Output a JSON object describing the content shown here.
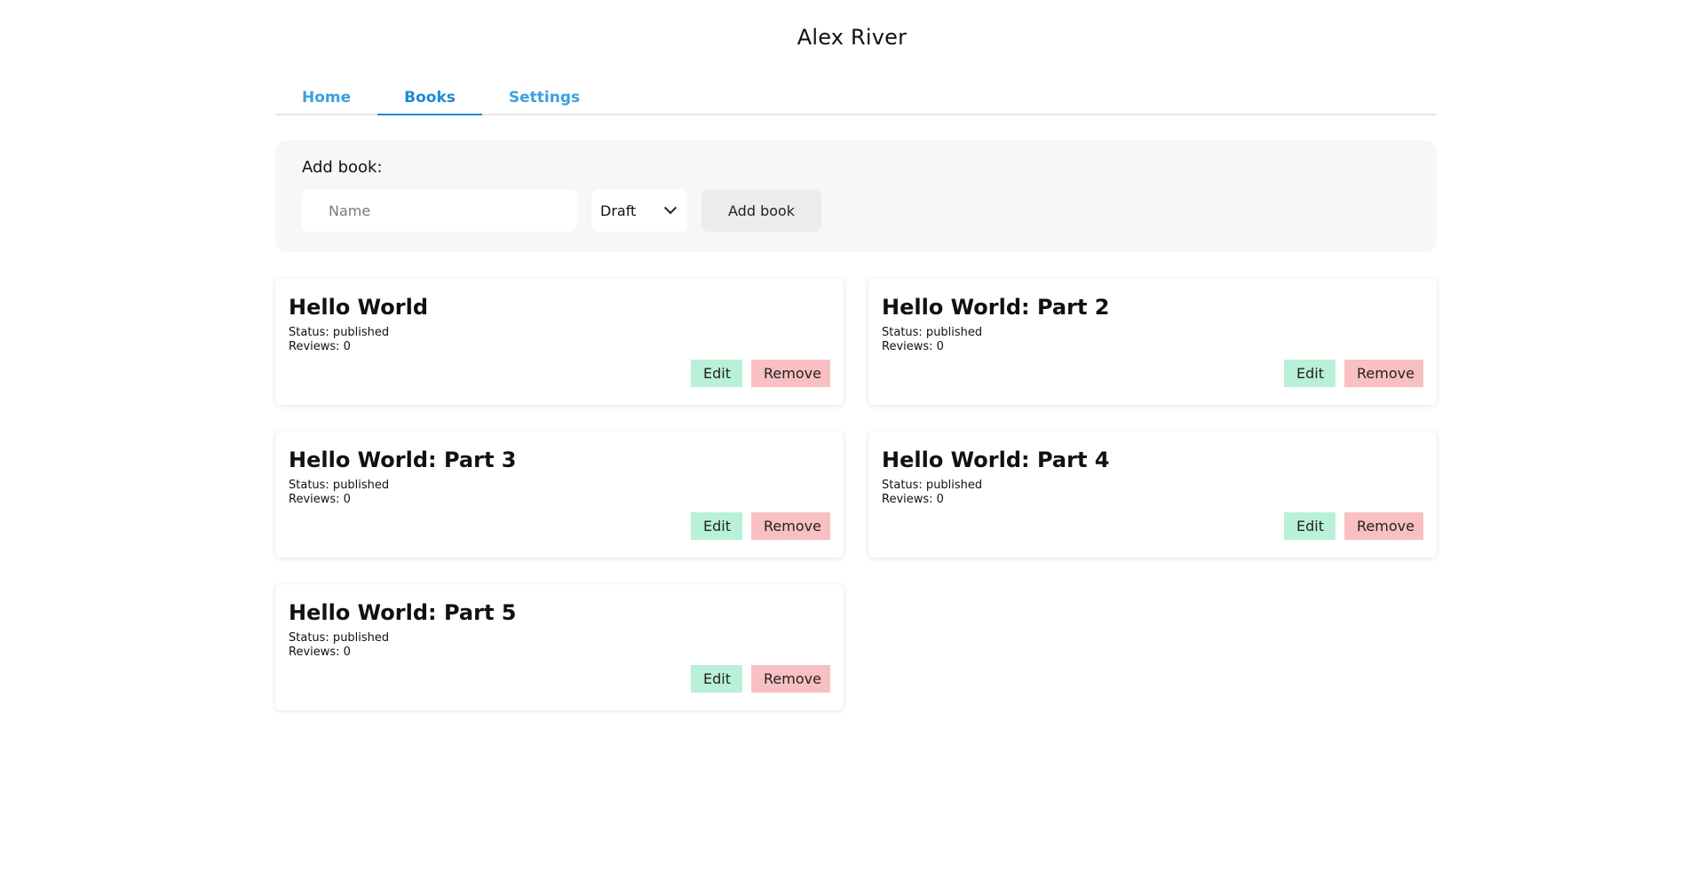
{
  "header": {
    "title": "Alex River"
  },
  "tabs": [
    {
      "label": "Home",
      "active": false
    },
    {
      "label": "Books",
      "active": true
    },
    {
      "label": "Settings",
      "active": false
    }
  ],
  "add_book": {
    "label": "Add book:",
    "name_placeholder": "Name",
    "name_value": "",
    "status_selected": "Draft",
    "submit_label": "Add book"
  },
  "books": [
    {
      "title": "Hello World",
      "status": "Status: published",
      "reviews": "Reviews: 0",
      "edit_label": "Edit",
      "remove_label": "Remove"
    },
    {
      "title": "Hello World: Part 2",
      "status": "Status: published",
      "reviews": "Reviews: 0",
      "edit_label": "Edit",
      "remove_label": "Remove"
    },
    {
      "title": "Hello World: Part 3",
      "status": "Status: published",
      "reviews": "Reviews: 0",
      "edit_label": "Edit",
      "remove_label": "Remove"
    },
    {
      "title": "Hello World: Part 4",
      "status": "Status: published",
      "reviews": "Reviews: 0",
      "edit_label": "Edit",
      "remove_label": "Remove"
    },
    {
      "title": "Hello World: Part 5",
      "status": "Status: published",
      "reviews": "Reviews: 0",
      "edit_label": "Edit",
      "remove_label": "Remove"
    }
  ],
  "colors": {
    "tab_text": "#3aa0e0",
    "tab_active": "#1c8ad6",
    "edit_bg": "#b8f0d8",
    "remove_bg": "#f8c0c2",
    "panel_bg": "#f7f7f7"
  }
}
